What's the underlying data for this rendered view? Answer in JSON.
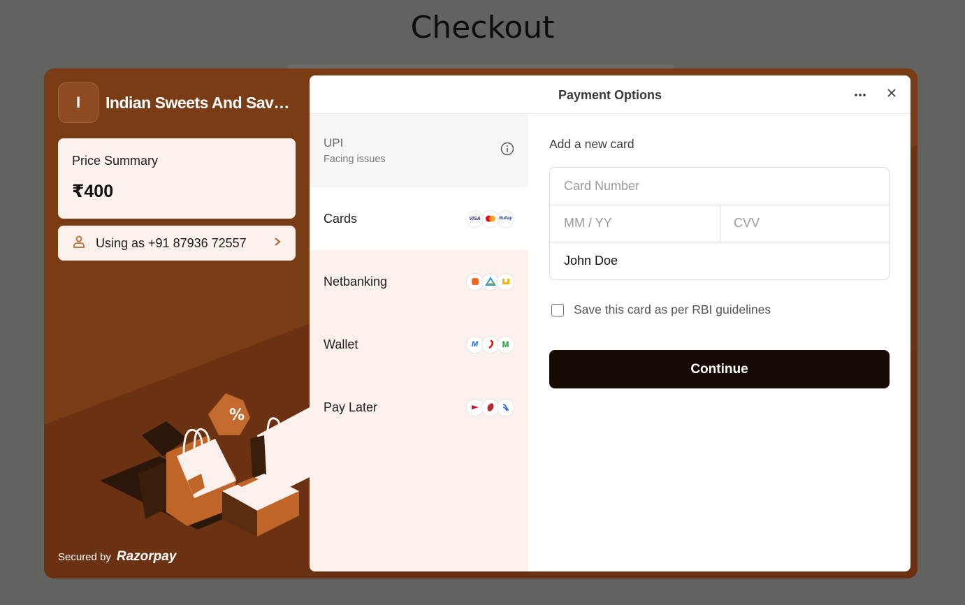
{
  "page": {
    "heading": "Checkout"
  },
  "merchant": {
    "initial": "I",
    "name": "Indian Sweets And Savouries"
  },
  "summary": {
    "label": "Price Summary",
    "amount": "₹400"
  },
  "contact": {
    "text": "Using as +91 87936 72557"
  },
  "footer": {
    "secured_by": "Secured by",
    "brand": "Razorpay"
  },
  "panel": {
    "title": "Payment Options"
  },
  "methods": [
    {
      "name": "UPI",
      "sub": "Facing issues",
      "icon": "info-icon"
    },
    {
      "name": "Cards",
      "icons": [
        "visa-icon",
        "mastercard-icon",
        "rupay-icon"
      ]
    },
    {
      "name": "Netbanking",
      "icons": [
        "bank-of-baroda-icon",
        "axis-bank-icon",
        "canara-bank-icon"
      ]
    },
    {
      "name": "Wallet",
      "icons": [
        "mobikwik-icon",
        "airtel-payments-icon",
        "m-wallet-icon"
      ]
    },
    {
      "name": "Pay Later",
      "icons": [
        "paylater-red-icon",
        "icici-icon",
        "lazypay-icon"
      ]
    }
  ],
  "card_form": {
    "title": "Add a new card",
    "card_number_placeholder": "Card Number",
    "expiry_placeholder": "MM / YY",
    "cvv_placeholder": "CVV",
    "name_value": "John Doe",
    "save_label": "Save this card as per RBI guidelines",
    "save_checked": false,
    "continue_label": "Continue"
  },
  "colors": {
    "background": "#626260",
    "accent": "#7a3c14",
    "panel_tint": "#fbf1ec",
    "button": "#160b05"
  }
}
